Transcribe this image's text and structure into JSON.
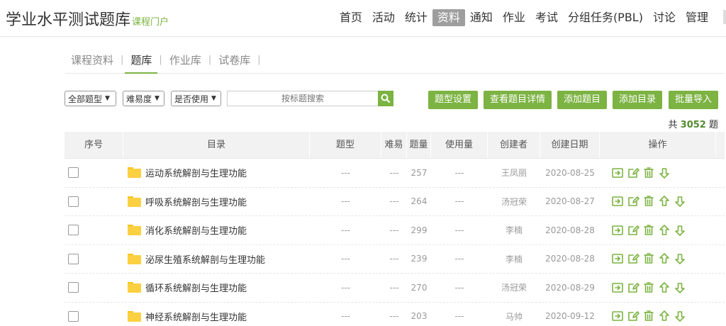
{
  "header": {
    "title": "学业水平测试题库",
    "subtitle": "课程门户",
    "nav": [
      {
        "label": "首页",
        "active": false
      },
      {
        "label": "活动",
        "active": false
      },
      {
        "label": "统计",
        "active": false
      },
      {
        "label": "资料",
        "active": true
      },
      {
        "label": "通知",
        "active": false
      },
      {
        "label": "作业",
        "active": false
      },
      {
        "label": "考试",
        "active": false
      },
      {
        "label": "分组任务(PBL)",
        "active": false
      },
      {
        "label": "讨论",
        "active": false
      },
      {
        "label": "管理",
        "active": false
      }
    ]
  },
  "subtabs": [
    {
      "label": "课程资料",
      "active": false
    },
    {
      "label": "题库",
      "active": true
    },
    {
      "label": "作业库",
      "active": false
    },
    {
      "label": "试卷库",
      "active": false
    }
  ],
  "toolbar": {
    "filters": [
      "全部题型",
      "难易度",
      "是否使用"
    ],
    "search_placeholder": "按标题搜索",
    "buttons": [
      "题型设置",
      "查看题目详情",
      "添加题目",
      "添加目录",
      "批量导入"
    ]
  },
  "total": {
    "prefix": "共",
    "count": "3052",
    "suffix": "题"
  },
  "table": {
    "columns": [
      "序号",
      "目录",
      "题型",
      "难易",
      "题量",
      "使用量",
      "创建者",
      "创建日期",
      "操作"
    ],
    "rows": [
      {
        "name": "运动系统解剖与生理功能",
        "type": "---",
        "difficulty": "---",
        "count": "257",
        "usage": "---",
        "creator": "王凤丽",
        "date": "2020-08-25",
        "has_up": false
      },
      {
        "name": "呼吸系统解剖与生理功能",
        "type": "---",
        "difficulty": "---",
        "count": "264",
        "usage": "---",
        "creator": "汤冠荣",
        "date": "2020-08-27",
        "has_up": true
      },
      {
        "name": "消化系统解剖与生理功能",
        "type": "---",
        "difficulty": "---",
        "count": "299",
        "usage": "---",
        "creator": "李楠",
        "date": "2020-08-28",
        "has_up": true
      },
      {
        "name": "泌尿生殖系统解剖与生理功能",
        "type": "---",
        "difficulty": "---",
        "count": "239",
        "usage": "---",
        "creator": "李楠",
        "date": "2020-08-28",
        "has_up": true
      },
      {
        "name": "循环系统解剖与生理功能",
        "type": "---",
        "difficulty": "---",
        "count": "270",
        "usage": "---",
        "creator": "汤冠荣",
        "date": "2020-08-29",
        "has_up": true
      },
      {
        "name": "神经系统解剖与生理功能",
        "type": "---",
        "difficulty": "---",
        "count": "203",
        "usage": "---",
        "creator": "马帅",
        "date": "2020-09-12",
        "has_up": true
      }
    ]
  },
  "colors": {
    "accent": "#7cb342",
    "active_nav": "#9e9e9e",
    "folder": "#fbd041"
  },
  "icons": {
    "search": "search-icon",
    "folder": "folder-icon",
    "move": "move-icon",
    "edit": "edit-icon",
    "delete": "trash-icon",
    "up": "arrow-up-icon",
    "down": "arrow-down-icon",
    "caret": "chevron-down-icon"
  }
}
